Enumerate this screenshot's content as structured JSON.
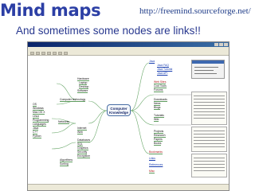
{
  "slide": {
    "title": "Mind maps",
    "url": "http://freemind.sourceforge.net/",
    "subtitle": "And sometimes some nodes are links!!"
  },
  "window": {
    "root_node": "Computer Knowledge",
    "left_branch_title": "Computer technology",
    "left_nodes": [
      "Hardware",
      "Laptop",
      "Desktop",
      "Software",
      "OS",
      "Windows",
      "Mac OS X",
      "Linux",
      "Programming",
      "Languages",
      "Java",
      "C++",
      "Python",
      "Networks",
      "Internet",
      "Web",
      "Databases",
      "SQL",
      "Graphics",
      "Security",
      "Encryption",
      "Algorithms",
      "Sorting"
    ],
    "right_top_nodes": [
      "Java",
      "Java FAQ",
      "Java Tutorial",
      "Java API"
    ],
    "right_mid_nodes": [
      "Web Sites",
      "Cool Tools",
      "Forums",
      "Downloads",
      "News",
      "Blogs",
      "Tutorials",
      "Wiki",
      "Projects",
      "Research",
      "Papers",
      "Books"
    ],
    "right_bottom_nodes": [
      "Bookmarks",
      "Links",
      "References",
      "Misc"
    ]
  },
  "colors": {
    "title": "#2c3fa5",
    "window_titlebar": "#0a246a",
    "root_border": "#4a6fa5",
    "link": "#1a3fb0"
  }
}
